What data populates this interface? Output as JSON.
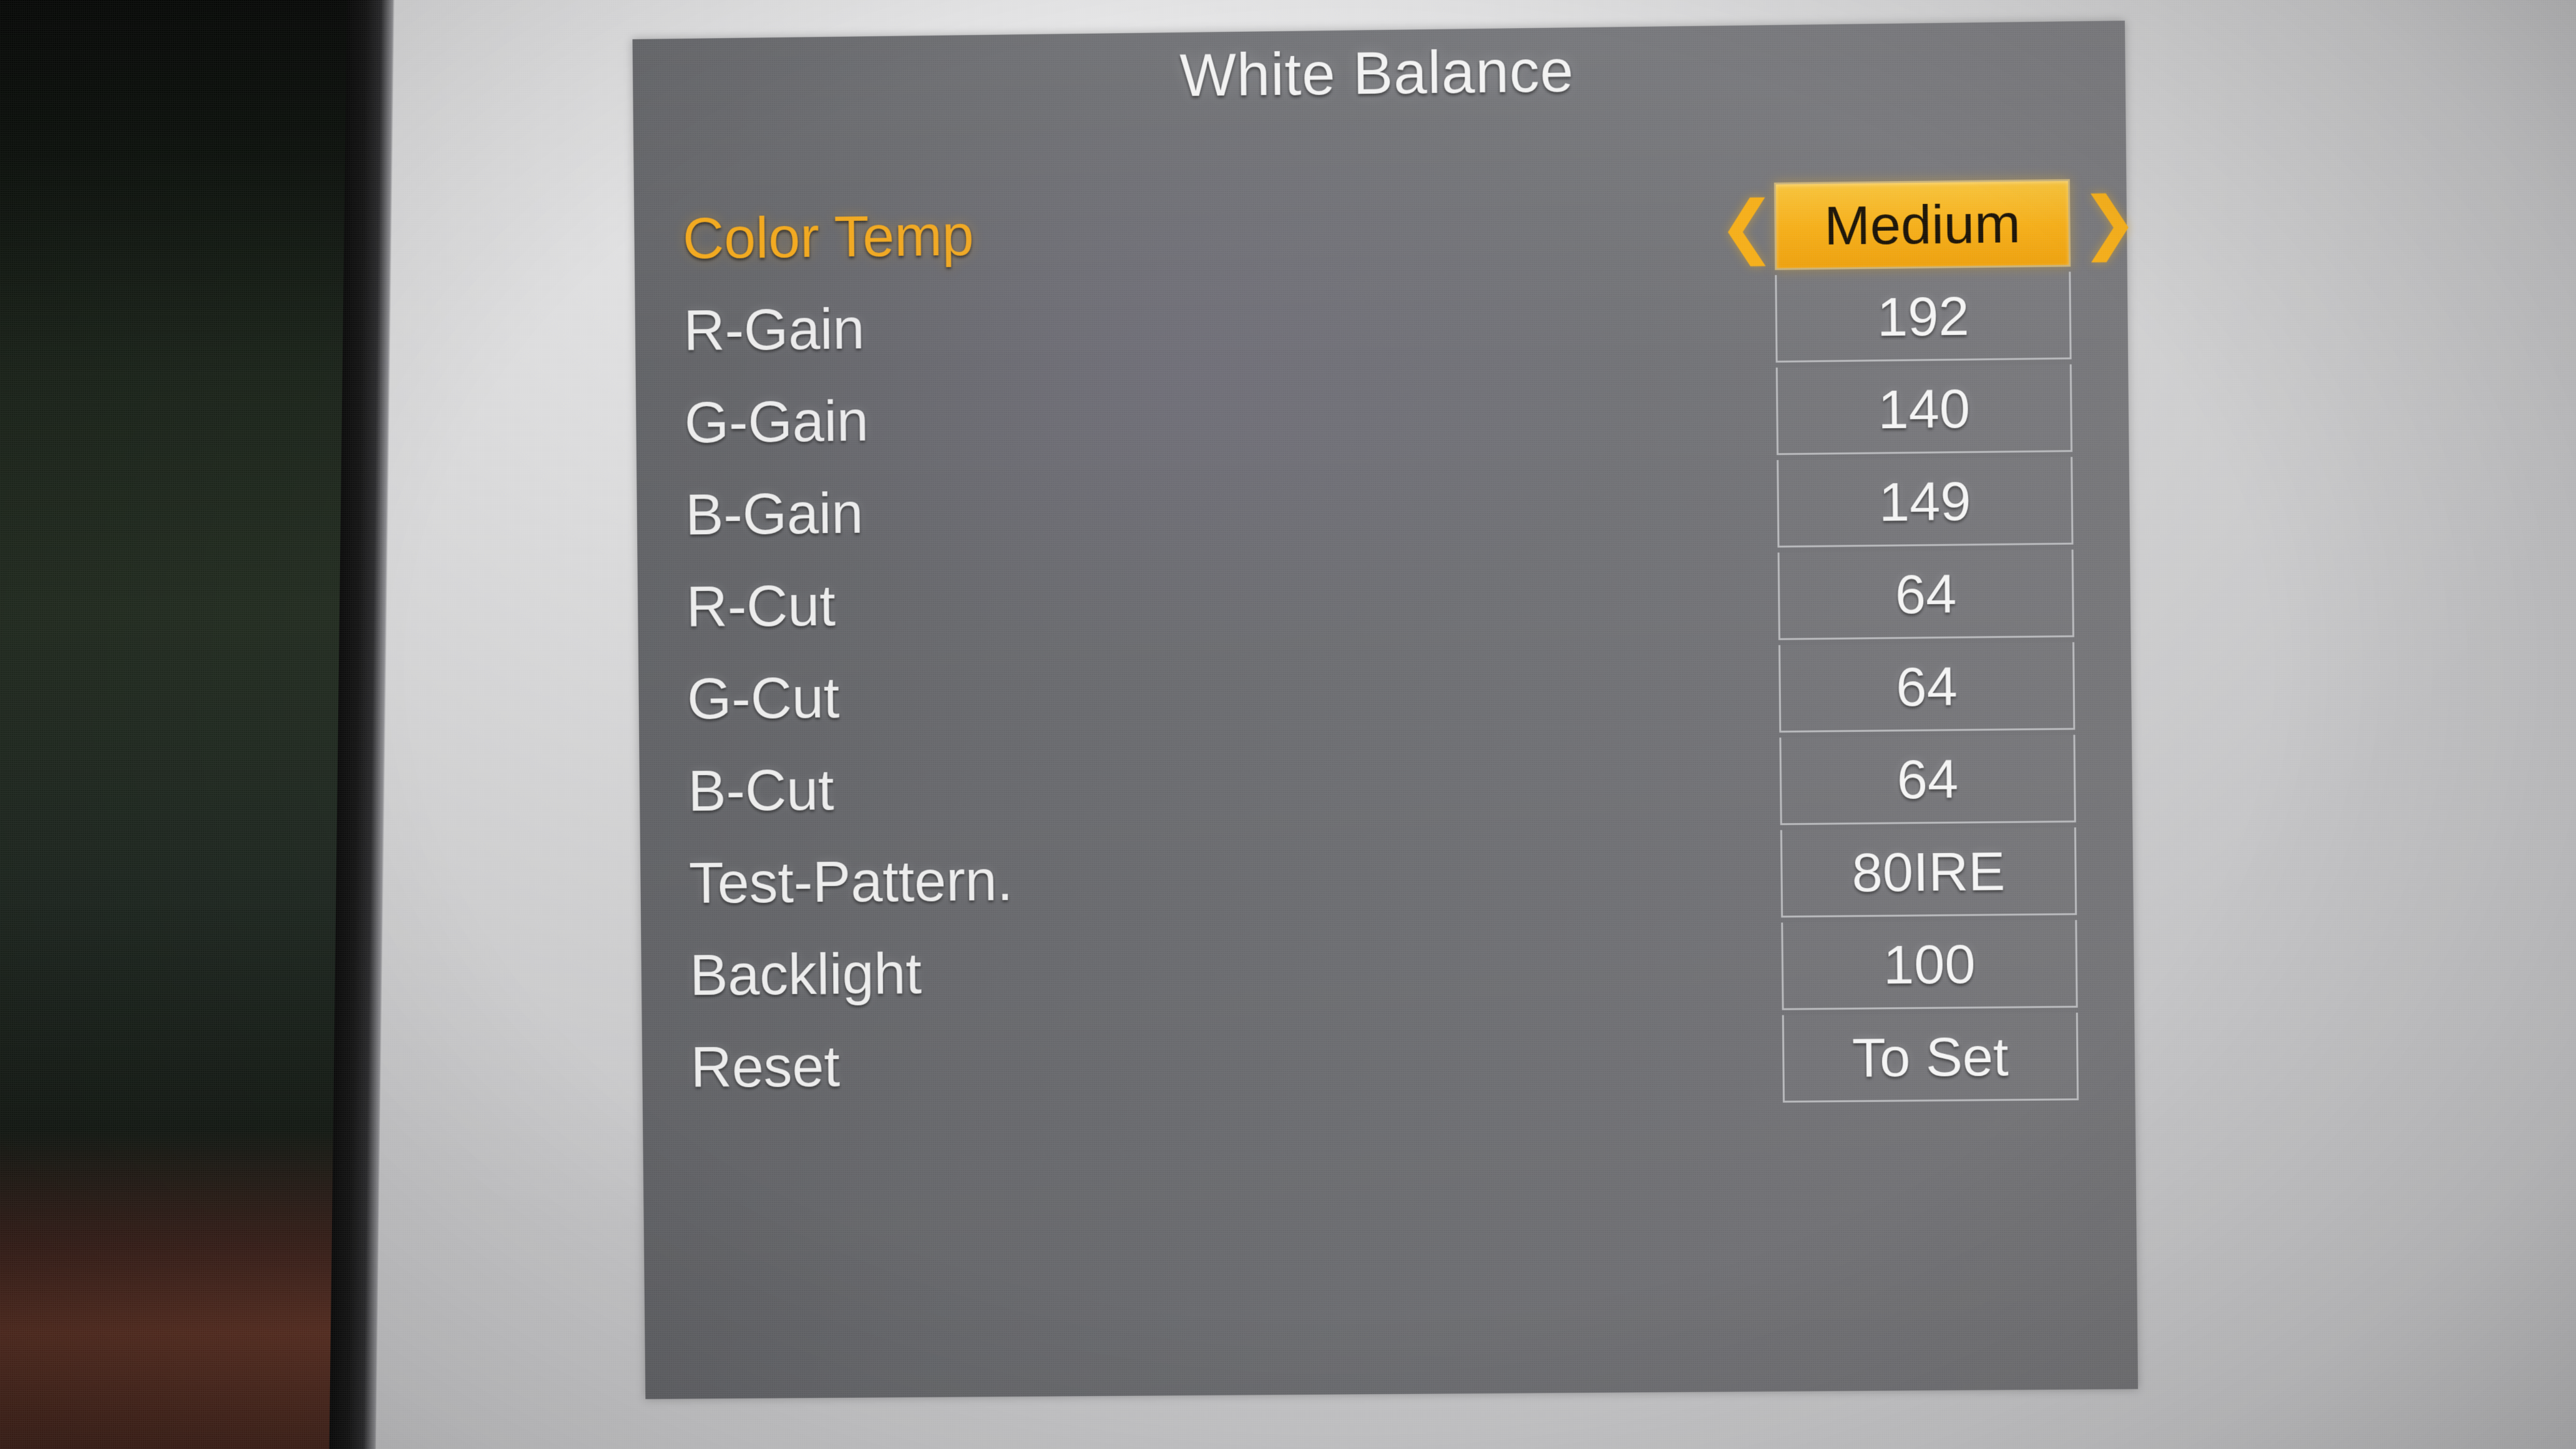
{
  "menu": {
    "title": "White Balance",
    "accent_color": "#f5ae18",
    "panel_color": "#6c6d71",
    "text_color": "#ececec",
    "rows": [
      {
        "label": "Color Temp",
        "value": "Medium",
        "selected": true,
        "type": "option"
      },
      {
        "label": "R-Gain",
        "value": "192",
        "selected": false,
        "type": "number"
      },
      {
        "label": "G-Gain",
        "value": "140",
        "selected": false,
        "type": "number"
      },
      {
        "label": "B-Gain",
        "value": "149",
        "selected": false,
        "type": "number"
      },
      {
        "label": "R-Cut",
        "value": "64",
        "selected": false,
        "type": "number"
      },
      {
        "label": "G-Cut",
        "value": "64",
        "selected": false,
        "type": "number"
      },
      {
        "label": "B-Cut",
        "value": "64",
        "selected": false,
        "type": "number"
      },
      {
        "label": "Test-Pattern.",
        "value": "80IRE",
        "selected": false,
        "type": "option"
      },
      {
        "label": "Backlight",
        "value": "100",
        "selected": false,
        "type": "number"
      },
      {
        "label": "Reset",
        "value": "To Set",
        "selected": false,
        "type": "action"
      }
    ],
    "nav": {
      "prev_icon": "chevron-left-icon",
      "next_icon": "chevron-right-icon",
      "prev_glyph": "❮",
      "next_glyph": "❯"
    }
  }
}
